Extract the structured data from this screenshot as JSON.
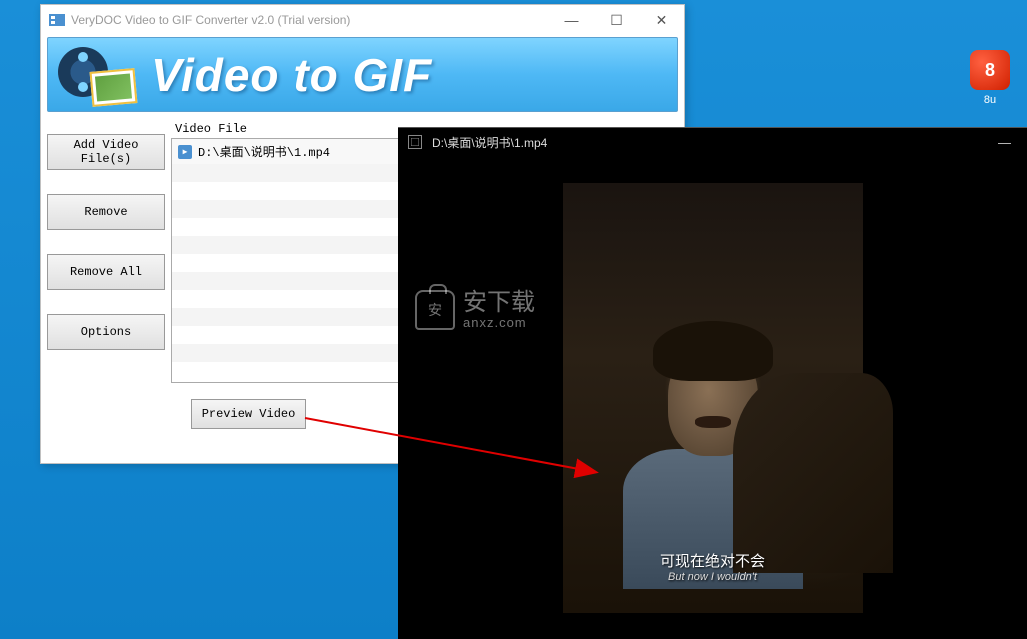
{
  "main_window": {
    "title": "VeryDOC Video to GIF Converter v2.0 (Trial version)",
    "banner_text": "Video to GIF",
    "sidebar": {
      "add_files": "Add Video File(s)",
      "remove": "Remove",
      "remove_all": "Remove All",
      "options": "Options"
    },
    "file_list": {
      "header": "Video File",
      "items": [
        {
          "path": "D:\\桌面\\说明书\\1.mp4"
        }
      ]
    },
    "actions": {
      "preview": "Preview Video"
    },
    "win_controls": {
      "min": "—",
      "max": "☐",
      "close": "✕"
    }
  },
  "preview_window": {
    "title": "D:\\桌面\\说明书\\1.mp4",
    "subtitle_cn": "可现在绝对不会",
    "subtitle_en": "But now I wouldn't",
    "win_controls": {
      "min": "—",
      "max": "☐",
      "close": "✕"
    }
  },
  "watermark": {
    "icon_glyph": "安",
    "cn": "安下载",
    "en": "anxz.com"
  },
  "desktop": {
    "icon_label": "8u",
    "icon_glyph": "8"
  }
}
